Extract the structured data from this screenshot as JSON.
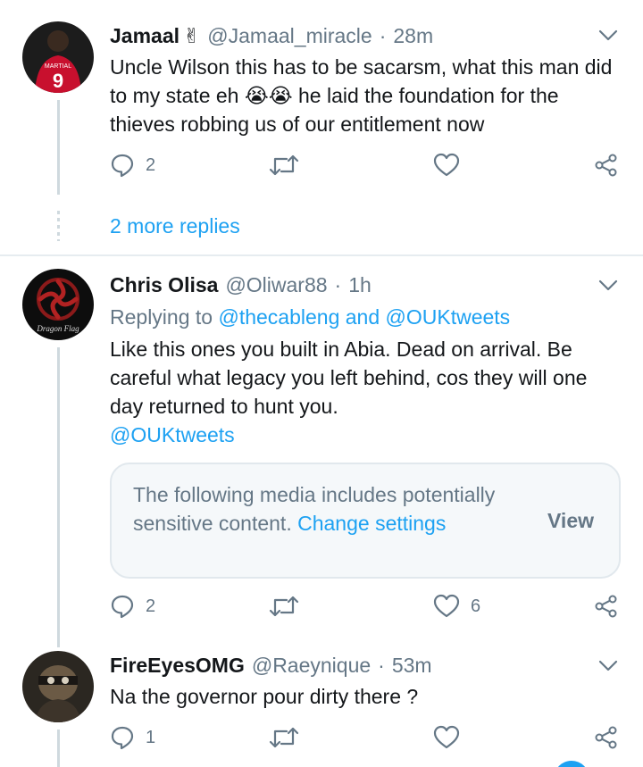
{
  "tweets": [
    {
      "name": "Jamaal",
      "name_emoji": "✌",
      "handle": "@Jamaal_miracle",
      "separator": "·",
      "time": "28m",
      "text": "Uncle Wilson this has to be sacarsm, what this man did to my state eh 😭😭 he laid the foundation for the thieves robbing us of our entitlement now",
      "reply_count": "2",
      "retweet_count": "",
      "like_count": "",
      "more_replies": "2 more replies"
    },
    {
      "name": "Chris Olisa",
      "handle": "@Oliwar88",
      "separator": "·",
      "time": "1h",
      "replying_prefix": "Replying to",
      "replying_to": "@thecableng and @OUKtweets",
      "text": "Like this ones you built in Abia. Dead on arrival. Be careful what legacy you left behind, cos they will one day returned to hunt you.",
      "mention": "@OUKtweets",
      "sensitive_message": "The following media includes potentially sensitive content.",
      "sensitive_link": "Change settings",
      "sensitive_view": "View",
      "avatar_caption": "Dragon Flag",
      "reply_count": "2",
      "retweet_count": "",
      "like_count": "6"
    },
    {
      "name": "FireEyesOMG",
      "handle": "@Raeynique",
      "separator": "·",
      "time": "53m",
      "text": "Na the governor pour dirty there ?",
      "reply_count": "1",
      "retweet_count": "",
      "like_count": ""
    }
  ],
  "avatar_jersey": {
    "label": "MARTIAL",
    "number": "9"
  },
  "colors": {
    "link": "#1da1f2",
    "muted": "#657786",
    "text": "#14171a",
    "jersey": "#c8102e"
  }
}
